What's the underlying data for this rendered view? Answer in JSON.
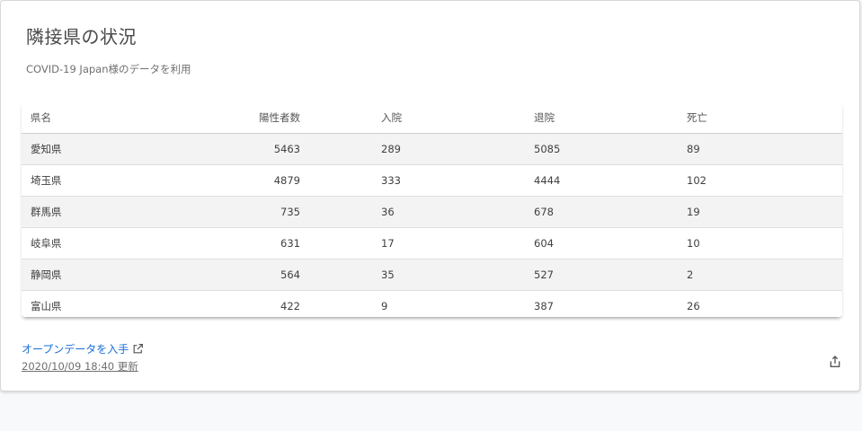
{
  "card": {
    "title": "隣接県の状況",
    "subtitle": "COVID-19 Japan様のデータを利用"
  },
  "table": {
    "headers": {
      "name": "県名",
      "positive": "陽性者数",
      "hospitalized": "入院",
      "discharged": "退院",
      "deaths": "死亡"
    },
    "rows": [
      {
        "name": "愛知県",
        "positive": "5463",
        "hospitalized": "289",
        "discharged": "5085",
        "deaths": "89"
      },
      {
        "name": "埼玉県",
        "positive": "4879",
        "hospitalized": "333",
        "discharged": "4444",
        "deaths": "102"
      },
      {
        "name": "群馬県",
        "positive": "735",
        "hospitalized": "36",
        "discharged": "678",
        "deaths": "19"
      },
      {
        "name": "岐阜県",
        "positive": "631",
        "hospitalized": "17",
        "discharged": "604",
        "deaths": "10"
      },
      {
        "name": "静岡県",
        "positive": "564",
        "hospitalized": "35",
        "discharged": "527",
        "deaths": "2"
      },
      {
        "name": "富山県",
        "positive": "422",
        "hospitalized": "9",
        "discharged": "387",
        "deaths": "26"
      }
    ]
  },
  "footer": {
    "open_data_label": "オープンデータを入手",
    "updated_label": "2020/10/09 18:40 更新",
    "link_icon": "external-link-icon",
    "share_icon": "share-icon"
  },
  "colors": {
    "link": "#1a6fd6",
    "row_stripe": "#f3f3f3",
    "background": "#f8f9fa"
  }
}
